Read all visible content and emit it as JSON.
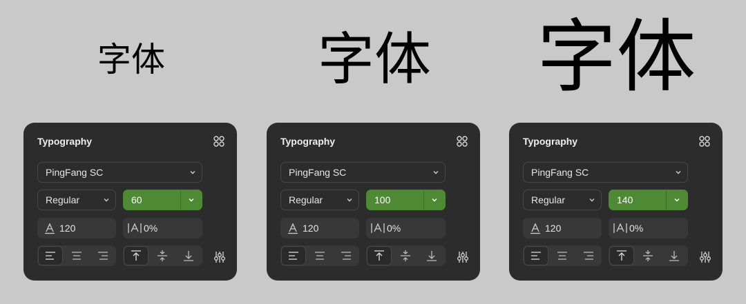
{
  "samples": [
    {
      "text": "字体"
    },
    {
      "text": "字体"
    },
    {
      "text": "字体"
    }
  ],
  "panels": [
    {
      "title": "Typography",
      "font_family": "PingFang SC",
      "weight": "Regular",
      "size": "60",
      "line_height": "120",
      "letter_spacing": "0%"
    },
    {
      "title": "Typography",
      "font_family": "PingFang SC",
      "weight": "Regular",
      "size": "100",
      "line_height": "120",
      "letter_spacing": "0%"
    },
    {
      "title": "Typography",
      "font_family": "PingFang SC",
      "weight": "Regular",
      "size": "140",
      "line_height": "120",
      "letter_spacing": "0%"
    }
  ],
  "icons": {
    "panel_menu": "grid-dots-icon",
    "dropdown": "chevron-down-icon",
    "line_height": "line-height-icon",
    "letter_spacing": "letter-spacing-icon",
    "align_left": "align-left-icon",
    "align_center": "align-center-icon",
    "align_right": "align-right-icon",
    "valign_top": "align-top-icon",
    "valign_middle": "align-middle-icon",
    "valign_bottom": "align-bottom-icon",
    "more_settings": "sliders-icon"
  },
  "colors": {
    "background": "#c9c9c9",
    "panel": "#2c2c2c",
    "accent_green": "#4e8a34",
    "text": "#e6e6e6"
  }
}
